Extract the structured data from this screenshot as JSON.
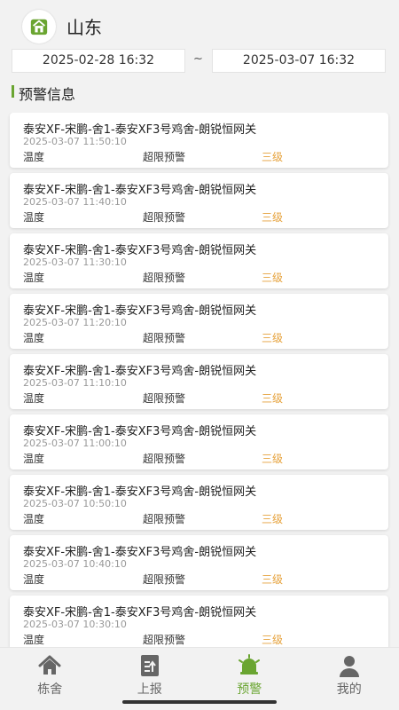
{
  "header": {
    "title": "山东"
  },
  "filter": {
    "start": "2025-02-28 16:32",
    "separator": "~",
    "end": "2025-03-07 16:32"
  },
  "section": {
    "title": "预警信息"
  },
  "alerts": [
    {
      "name": "泰安XF-宋鹏-舍1-泰安XF3号鸡舍-朗锐恒网关",
      "time": "2025-03-07 11:50:10",
      "type": "温度",
      "kind": "超限预警",
      "level": "三级"
    },
    {
      "name": "泰安XF-宋鹏-舍1-泰安XF3号鸡舍-朗锐恒网关",
      "time": "2025-03-07 11:40:10",
      "type": "温度",
      "kind": "超限预警",
      "level": "三级"
    },
    {
      "name": "泰安XF-宋鹏-舍1-泰安XF3号鸡舍-朗锐恒网关",
      "time": "2025-03-07 11:30:10",
      "type": "温度",
      "kind": "超限预警",
      "level": "三级"
    },
    {
      "name": "泰安XF-宋鹏-舍1-泰安XF3号鸡舍-朗锐恒网关",
      "time": "2025-03-07 11:20:10",
      "type": "温度",
      "kind": "超限预警",
      "level": "三级"
    },
    {
      "name": "泰安XF-宋鹏-舍1-泰安XF3号鸡舍-朗锐恒网关",
      "time": "2025-03-07 11:10:10",
      "type": "温度",
      "kind": "超限预警",
      "level": "三级"
    },
    {
      "name": "泰安XF-宋鹏-舍1-泰安XF3号鸡舍-朗锐恒网关",
      "time": "2025-03-07 11:00:10",
      "type": "温度",
      "kind": "超限预警",
      "level": "三级"
    },
    {
      "name": "泰安XF-宋鹏-舍1-泰安XF3号鸡舍-朗锐恒网关",
      "time": "2025-03-07 10:50:10",
      "type": "温度",
      "kind": "超限预警",
      "level": "三级"
    },
    {
      "name": "泰安XF-宋鹏-舍1-泰安XF3号鸡舍-朗锐恒网关",
      "time": "2025-03-07 10:40:10",
      "type": "温度",
      "kind": "超限预警",
      "level": "三级"
    },
    {
      "name": "泰安XF-宋鹏-舍1-泰安XF3号鸡舍-朗锐恒网关",
      "time": "2025-03-07 10:30:10",
      "type": "温度",
      "kind": "超限预警",
      "level": "三级"
    }
  ],
  "tabs": [
    {
      "label": "栋舍",
      "icon": "home-icon"
    },
    {
      "label": "上报",
      "icon": "report-icon"
    },
    {
      "label": "预警",
      "icon": "alarm-bell-icon",
      "active": true
    },
    {
      "label": "我的",
      "icon": "user-icon"
    }
  ],
  "colors": {
    "accent": "#6aa531",
    "warning_level": "#e6a23c",
    "tab_inactive": "#666666"
  }
}
